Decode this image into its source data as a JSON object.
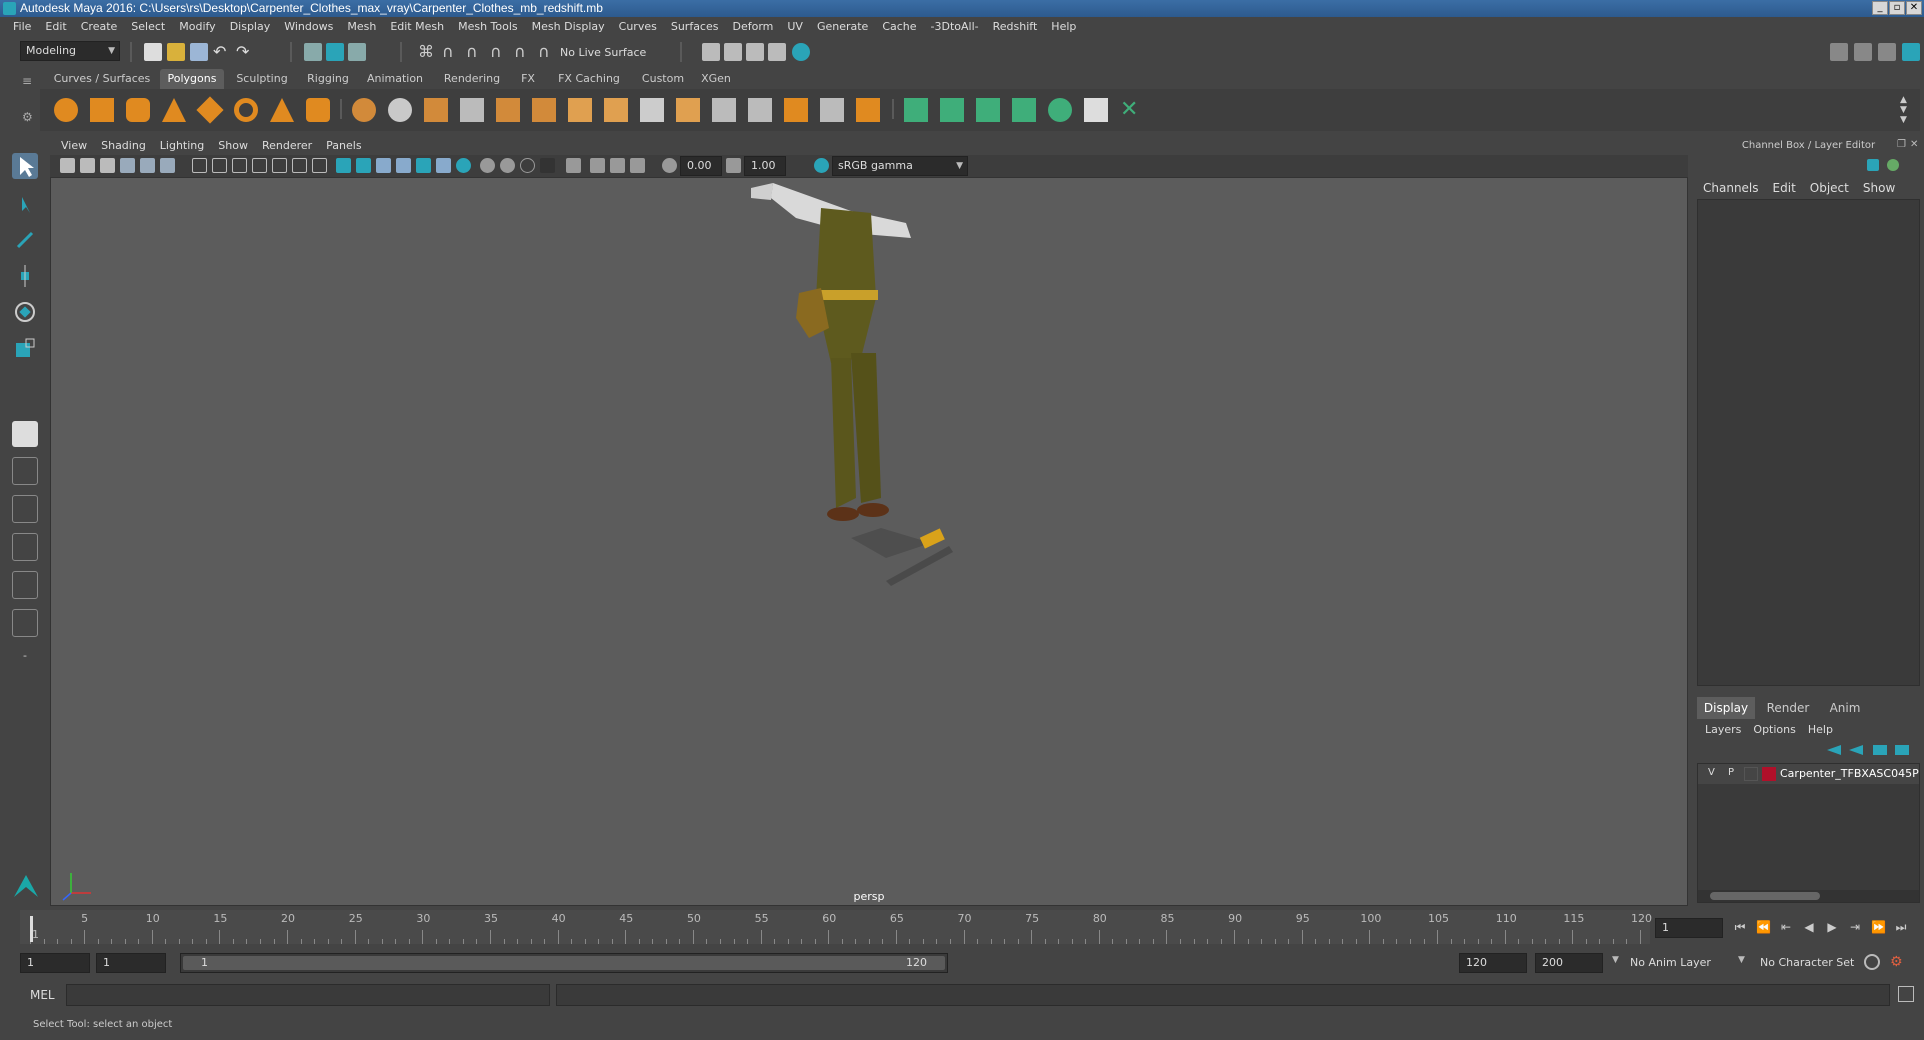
{
  "window": {
    "title": "Autodesk Maya 2016: C:\\Users\\rs\\Desktop\\Carpenter_Clothes_max_vray\\Carpenter_Clothes_mb_redshift.mb"
  },
  "menubar": {
    "items": [
      "File",
      "Edit",
      "Create",
      "Select",
      "Modify",
      "Display",
      "Windows",
      "Mesh",
      "Edit Mesh",
      "Mesh Tools",
      "Mesh Display",
      "Curves",
      "Surfaces",
      "Deform",
      "UV",
      "Generate",
      "Cache",
      "-3DtoAll-",
      "Redshift",
      "Help"
    ]
  },
  "statusline": {
    "mode": "Modeling",
    "live_surface": "No Live Surface"
  },
  "shelf": {
    "tabs": [
      "Curves / Surfaces",
      "Polygons",
      "Sculpting",
      "Rigging",
      "Animation",
      "Rendering",
      "FX",
      "FX Caching",
      "Custom",
      "XGen"
    ],
    "active_tab": "Polygons"
  },
  "viewport": {
    "menu": [
      "View",
      "Shading",
      "Lighting",
      "Show",
      "Renderer",
      "Panels"
    ],
    "exposure": "0.00",
    "gamma": "1.00",
    "color_space": "sRGB gamma",
    "camera_label": "persp"
  },
  "channelbox": {
    "title": "Channel Box / Layer Editor",
    "menu": [
      "Channels",
      "Edit",
      "Object",
      "Show"
    ]
  },
  "layereditor": {
    "tabs": [
      "Display",
      "Render",
      "Anim"
    ],
    "active_tab": "Display",
    "menu": [
      "Layers",
      "Options",
      "Help"
    ],
    "layer": {
      "visible": "V",
      "playback": "P",
      "name": "Carpenter_TFBXASC045P",
      "color": "#b0102a"
    }
  },
  "timeslider": {
    "labels": [
      "1",
      "5",
      "10",
      "15",
      "20",
      "25",
      "30",
      "35",
      "40",
      "45",
      "50",
      "55",
      "60",
      "65",
      "70",
      "75",
      "80",
      "85",
      "90",
      "95",
      "100",
      "105",
      "110",
      "115",
      "120"
    ],
    "current_frame": "1"
  },
  "rangeslider": {
    "start_frame": "1",
    "range_start": "1",
    "range_start_inner": "1",
    "range_end_inner": "120",
    "range_end": "120",
    "end_frame": "200",
    "anim_layer": "No Anim Layer",
    "character_set": "No Character Set"
  },
  "cmdline": {
    "label": "MEL"
  },
  "helpline": {
    "text": "Select Tool: select an object"
  },
  "colors": {
    "accent": "#2aa4b8",
    "shelf_icon": "#e08a20",
    "shelf_green": "#3fae7a",
    "viewport_bg": "#5c5c5c"
  }
}
